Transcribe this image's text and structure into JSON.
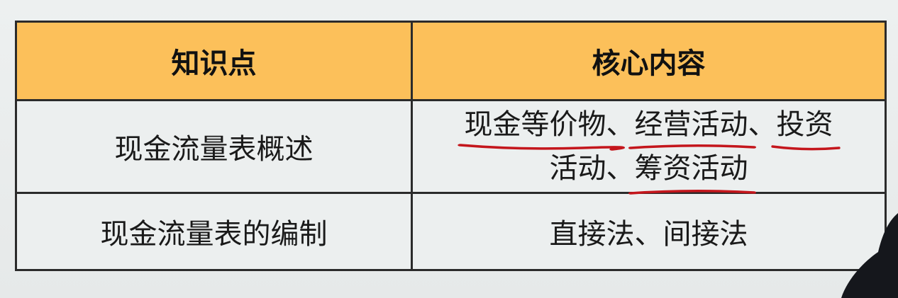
{
  "table": {
    "headers": [
      "知识点",
      "核心内容"
    ],
    "rows": [
      {
        "topic": "现金流量表概述",
        "content": {
          "line1": {
            "item1": "现金等价物",
            "sep1": "、",
            "item2": "经营活动",
            "sep2": "、",
            "item3a": "投资"
          },
          "line2": {
            "item3b": "活动",
            "sep3": "、",
            "item4": "筹资活动"
          }
        }
      },
      {
        "topic": "现金流量表的编制",
        "content": "直接法、间接法"
      }
    ]
  },
  "colors": {
    "header_bg": "#fcc05a",
    "annotation": "#c4161c"
  }
}
